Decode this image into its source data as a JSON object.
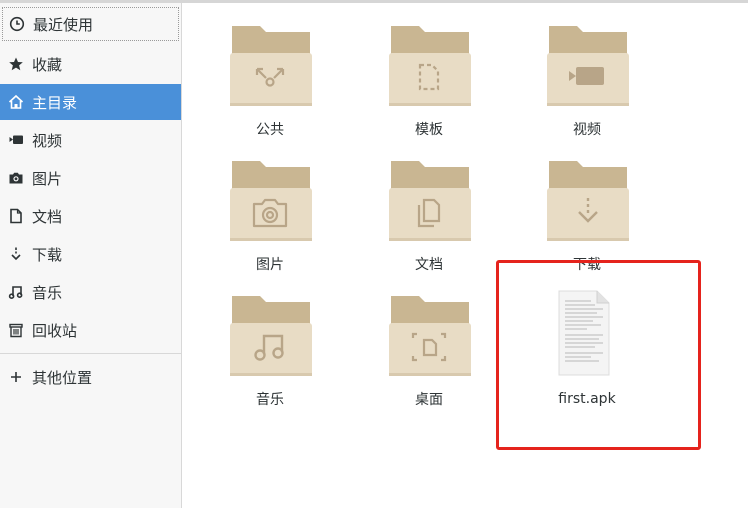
{
  "sidebar": {
    "items": [
      {
        "label": "最近使用",
        "icon": "clock-icon"
      },
      {
        "label": "收藏",
        "icon": "star-icon"
      },
      {
        "label": "主目录",
        "icon": "home-icon"
      },
      {
        "label": "视频",
        "icon": "video-icon"
      },
      {
        "label": "图片",
        "icon": "camera-icon"
      },
      {
        "label": "文档",
        "icon": "document-icon"
      },
      {
        "label": "下载",
        "icon": "download-icon"
      },
      {
        "label": "音乐",
        "icon": "music-icon"
      },
      {
        "label": "回收站",
        "icon": "trash-icon"
      }
    ],
    "other_locations": {
      "label": "其他位置",
      "icon": "plus-icon"
    },
    "active_item": "主目录"
  },
  "files": [
    {
      "name": "公共",
      "type": "folder",
      "emblem": "share-icon"
    },
    {
      "name": "模板",
      "type": "folder",
      "emblem": "template-icon"
    },
    {
      "name": "视频",
      "type": "folder",
      "emblem": "video-icon"
    },
    {
      "name": "图片",
      "type": "folder",
      "emblem": "camera-icon"
    },
    {
      "name": "文档",
      "type": "folder",
      "emblem": "documents-icon"
    },
    {
      "name": "下载",
      "type": "folder",
      "emblem": "download-icon"
    },
    {
      "name": "音乐",
      "type": "folder",
      "emblem": "music-icon"
    },
    {
      "name": "桌面",
      "type": "folder",
      "emblem": "desktop-icon"
    },
    {
      "name": "first.apk",
      "type": "file",
      "emblem": "text-document-icon"
    }
  ],
  "colors": {
    "accent": "#4a90d9",
    "folder_back": "#c9b692",
    "folder_front": "#e8dcc5",
    "folder_emblem": "#b8a588",
    "highlight": "#e5231d",
    "sidebar_bg": "#f7f7f7"
  }
}
